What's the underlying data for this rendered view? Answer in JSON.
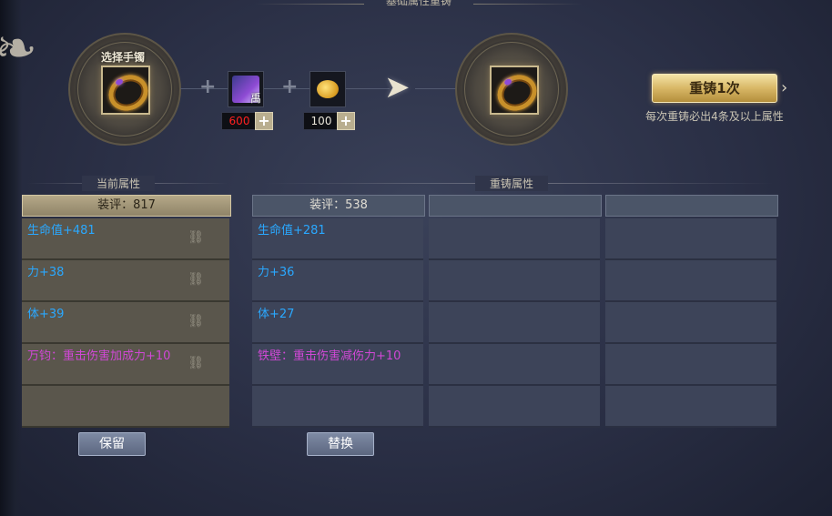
{
  "panel_title": "基础属性重铸",
  "select_label": "选择手镯",
  "materials": {
    "book_char": "禹",
    "book_count": "600",
    "coin_count": "100",
    "plus_symbol": "+"
  },
  "reforge_button": "重铸1次",
  "hint": "每次重铸必出4条及以上属性",
  "current": {
    "section_title": "当前属性",
    "score": "装评：817",
    "attributes": [
      {
        "text": "生命值+481",
        "color": "blue"
      },
      {
        "text": "力+38",
        "color": "blue"
      },
      {
        "text": "体+39",
        "color": "blue"
      },
      {
        "text": "万钧：重击伤害加成力+10",
        "color": "purple"
      },
      {
        "text": "",
        "color": ""
      }
    ],
    "keep_button": "保留"
  },
  "reforged": {
    "section_title": "重铸属性",
    "score": "装评：538",
    "attributes": [
      {
        "text": "生命值+281",
        "color": "blue"
      },
      {
        "text": "力+36",
        "color": "blue"
      },
      {
        "text": "体+27",
        "color": "blue"
      },
      {
        "text": "铁壁：重击伤害减伤力+10",
        "color": "purple"
      },
      {
        "text": "",
        "color": ""
      }
    ],
    "replace_button": "替换"
  },
  "colors": {
    "attr_blue": "#2aa8ff",
    "attr_purple": "#d048d6",
    "gold_button": "#d8b766"
  }
}
